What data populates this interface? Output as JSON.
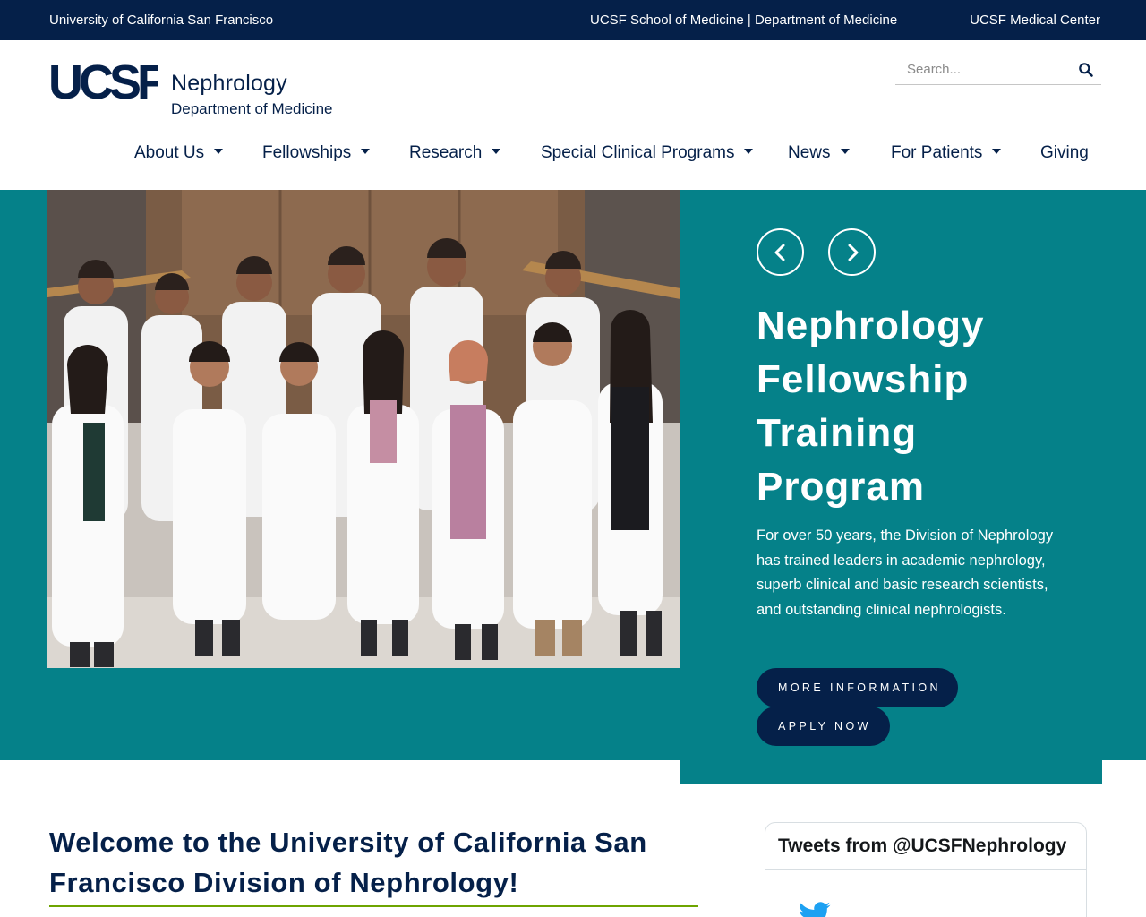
{
  "utility_bar": {
    "university": "University of California San Francisco",
    "school": "UCSF School of Medicine | Department of Medicine",
    "medical_center": "UCSF Medical Center"
  },
  "header": {
    "logo_mark": "UCSF",
    "site_name": "Nephrology",
    "department": "Department of Medicine"
  },
  "search": {
    "placeholder": "Search...",
    "icon": "search-icon"
  },
  "nav": {
    "items": [
      {
        "label": "About Us",
        "has_dropdown": true
      },
      {
        "label": "Fellowships",
        "has_dropdown": true
      },
      {
        "label": "Research",
        "has_dropdown": true
      },
      {
        "label": "Special Clinical Programs",
        "has_dropdown": true
      },
      {
        "label": "News",
        "has_dropdown": true
      },
      {
        "label": "For Patients",
        "has_dropdown": true
      },
      {
        "label": "Giving",
        "has_dropdown": false
      }
    ]
  },
  "hero": {
    "title": "Nephrology Fellowship Training Program",
    "description": "For over 50 years, the Division of Nephrology has trained leaders in academic nephrology, superb clinical and basic research scientists, and outstanding clinical nephrologists.",
    "primary_button": "MORE INFORMATION",
    "secondary_button": "APPLY NOW",
    "prev_icon": "chevron-left-icon",
    "next_icon": "chevron-right-icon"
  },
  "welcome": {
    "title": "Welcome to the University of California San Francisco Division of Nephrology!"
  },
  "tweets": {
    "title": "Tweets from @UCSFNephrology",
    "icon": "twitter-bird-icon"
  },
  "colors": {
    "navy": "#052049",
    "teal": "#058189",
    "accent_green": "#6ea400",
    "white": "#ffffff"
  }
}
